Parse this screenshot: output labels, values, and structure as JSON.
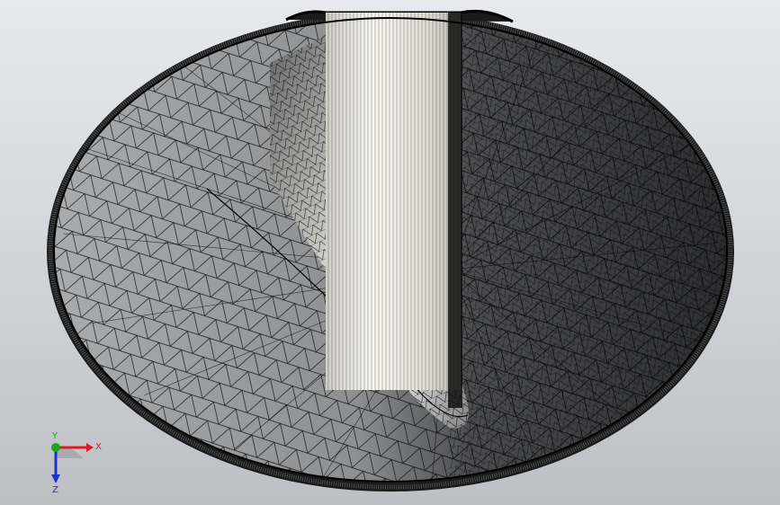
{
  "view": {
    "background_top": "#e7e9ec",
    "background_bottom": "#bcc0c4"
  },
  "model": {
    "icon": "3d-mesh-model",
    "outer_fill": "#7f8183",
    "left_shade": "#a3a5a7",
    "right_shade": "#303133",
    "stem_highlight": "#fbfbf3",
    "mesh_color": "#000000"
  },
  "triad": {
    "x_label": "X",
    "y_label": "Y",
    "z_label": "Z",
    "x_color": "#e31a1c",
    "y_color": "#18a818",
    "z_color": "#1f2fd0"
  }
}
